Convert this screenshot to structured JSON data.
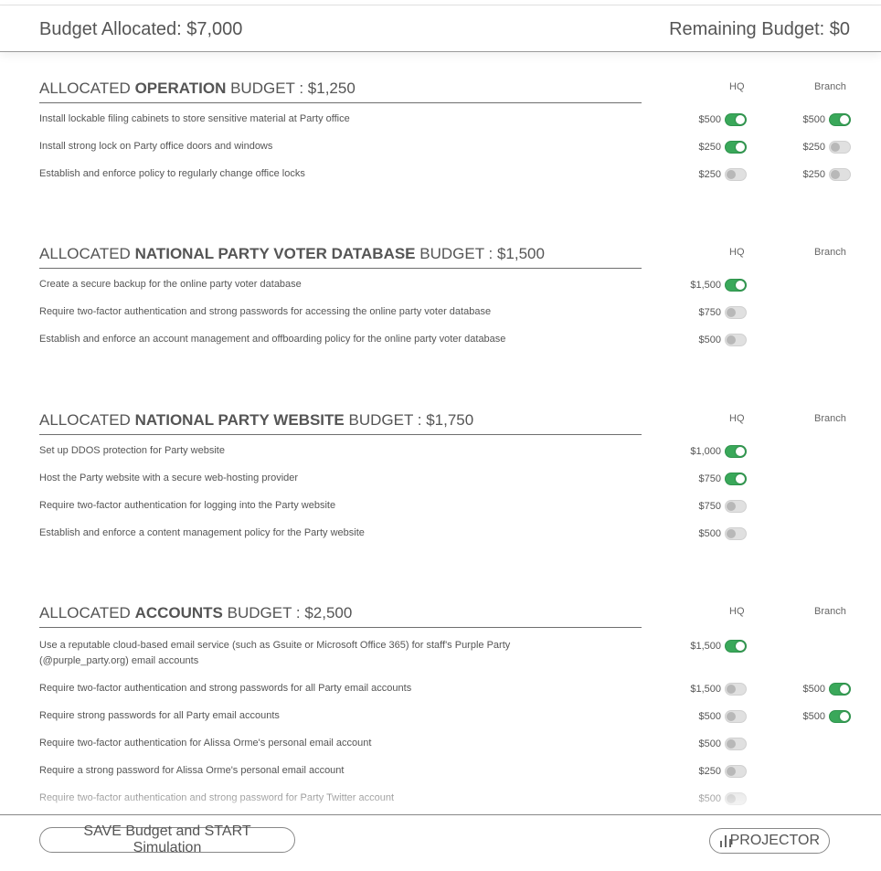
{
  "header": {
    "budget_allocated": "Budget Allocated: $7,000",
    "remaining_budget": "Remaining Budget: $0"
  },
  "columns": {
    "hq": "HQ",
    "branch": "Branch"
  },
  "sections": [
    {
      "title_pre": "ALLOCATED ",
      "title_bold": "OPERATION",
      "title_post": " BUDGET : $1,250",
      "items": [
        {
          "text": "Install lockable filing cabinets to store sensitive material at Party office",
          "hq": "$500",
          "hq_on": true,
          "branch": "$500",
          "branch_on": true
        },
        {
          "text": "Install strong lock on Party office doors and windows",
          "hq": "$250",
          "hq_on": true,
          "branch": "$250",
          "branch_on": false
        },
        {
          "text": "Establish and enforce policy to regularly change office locks",
          "hq": "$250",
          "hq_on": false,
          "branch": "$250",
          "branch_on": false
        }
      ]
    },
    {
      "title_pre": "ALLOCATED ",
      "title_bold": "NATIONAL PARTY VOTER DATABASE",
      "title_post": " BUDGET : $1,500",
      "items": [
        {
          "text": "Create a secure backup for the online party voter database",
          "hq": "$1,500",
          "hq_on": true
        },
        {
          "text": "Require two-factor authentication and strong passwords for accessing the online party voter database",
          "hq": "$750",
          "hq_on": false
        },
        {
          "text": "Establish and enforce an account management and offboarding policy for the online party voter database",
          "hq": "$500",
          "hq_on": false
        }
      ]
    },
    {
      "title_pre": "ALLOCATED ",
      "title_bold": "NATIONAL PARTY WEBSITE",
      "title_post": " BUDGET : $1,750",
      "items": [
        {
          "text": "Set up DDOS protection for Party website",
          "hq": "$1,000",
          "hq_on": true
        },
        {
          "text": "Host the Party website with a secure web-hosting provider",
          "hq": "$750",
          "hq_on": true
        },
        {
          "text": "Require two-factor authentication for logging into the Party website",
          "hq": "$750",
          "hq_on": false
        },
        {
          "text": "Establish and enforce a content management policy for the Party website",
          "hq": "$500",
          "hq_on": false
        }
      ]
    },
    {
      "title_pre": "ALLOCATED ",
      "title_bold": "ACCOUNTS",
      "title_post": " BUDGET : $2,500",
      "items": [
        {
          "text": "Use a reputable cloud-based email service (such as Gsuite or Microsoft Office 365) for staff's Purple Party (@purple_party.org) email accounts",
          "hq": "$1,500",
          "hq_on": true
        },
        {
          "text": "Require two-factor authentication and strong passwords for all Party email accounts",
          "hq": "$1,500",
          "hq_on": false,
          "branch": "$500",
          "branch_on": true
        },
        {
          "text": "Require strong passwords for all Party email accounts",
          "hq": "$500",
          "hq_on": false,
          "branch": "$500",
          "branch_on": true
        },
        {
          "text": "Require two-factor authentication for Alissa Orme's personal email account",
          "hq": "$500",
          "hq_on": false
        },
        {
          "text": "Require a strong password for Alissa Orme's personal email account",
          "hq": "$250",
          "hq_on": false
        },
        {
          "text": "Require two-factor authentication and strong password for Party Twitter account",
          "hq": "$500",
          "hq_on": false
        }
      ]
    }
  ],
  "footer": {
    "save_label": "SAVE Budget and START Simulation",
    "projector_label": "PROJECTOR",
    "projector_icon": "bar-chart-icon"
  },
  "colors": {
    "toggle_on": "#3aa85a",
    "toggle_off": "#e0e0e0",
    "text": "#555555"
  }
}
